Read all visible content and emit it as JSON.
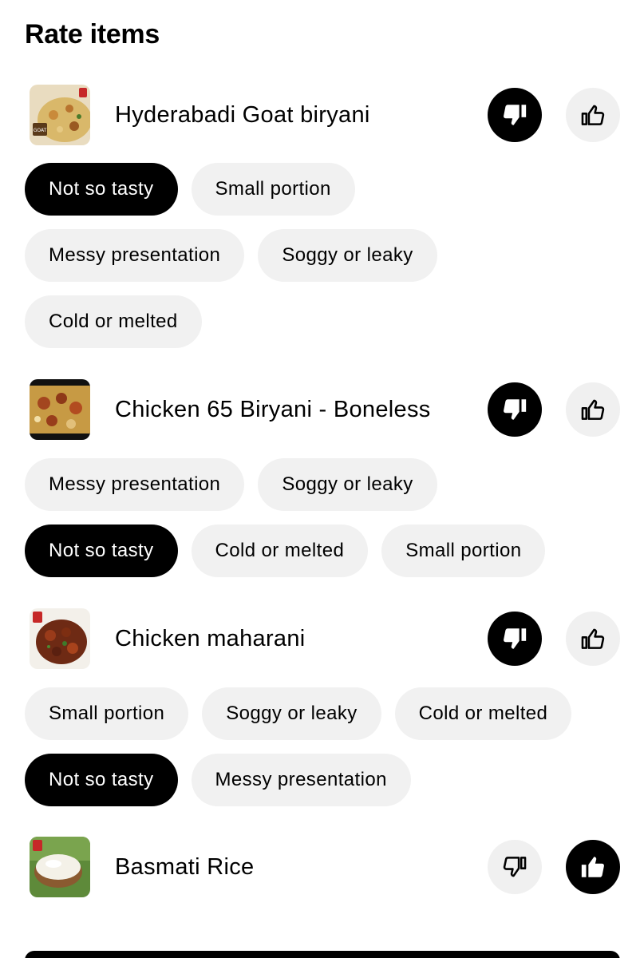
{
  "title": "Rate items",
  "colors": {
    "selected": "#000000",
    "chip": "#f1f1f1",
    "button_inactive": "#f0f0f0"
  },
  "items": [
    {
      "name": "Hyderabadi Goat biryani",
      "thumb_label": "GOAT",
      "rating": "thumbs-down",
      "chips": [
        [
          "Not so tasty",
          "Small portion"
        ],
        [
          "Messy presentation",
          "Soggy or leaky"
        ],
        [
          "Cold or melted"
        ]
      ],
      "selected_chips": [
        "Not so tasty"
      ]
    },
    {
      "name": "Chicken 65 Biryani - Boneless",
      "rating": "thumbs-down",
      "chips": [
        [
          "Messy presentation",
          "Soggy or leaky"
        ],
        [
          "Not so tasty",
          "Cold or melted",
          "Small portion"
        ]
      ],
      "selected_chips": [
        "Not so tasty"
      ]
    },
    {
      "name": "Chicken maharani",
      "rating": "thumbs-down",
      "chips": [
        [
          "Small portion",
          "Soggy or leaky",
          "Cold or melted"
        ],
        [
          "Not so tasty",
          "Messy presentation"
        ]
      ],
      "selected_chips": [
        "Not so tasty"
      ]
    },
    {
      "name": "Basmati Rice",
      "rating": "thumbs-up"
    }
  ]
}
